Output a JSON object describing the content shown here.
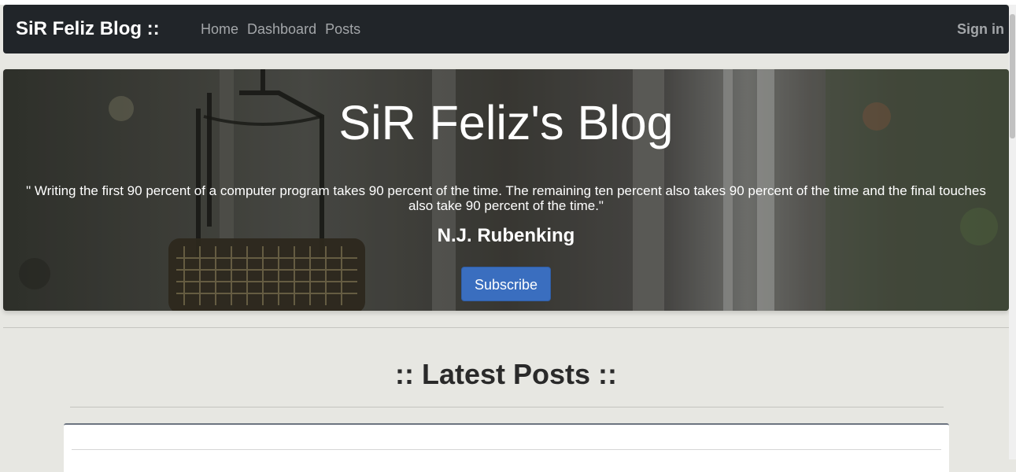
{
  "navbar": {
    "brand": "SiR Feliz Blog ::",
    "links": [
      "Home",
      "Dashboard",
      "Posts"
    ],
    "signin": "Sign in"
  },
  "hero": {
    "title": "SiR Feliz's Blog",
    "quote": "\" Writing the first 90 percent of a computer program takes 90 percent of the time. The remaining ten percent also takes 90 percent of the time and the final touches also take 90 percent of the time.\"",
    "author": "N.J. Rubenking",
    "subscribe_label": "Subscribe"
  },
  "latest_posts": {
    "title": ":: Latest Posts ::"
  },
  "colors": {
    "navbar_bg": "#212529",
    "page_bg": "#e7e7e2",
    "button_primary": "#3a6ebf"
  }
}
